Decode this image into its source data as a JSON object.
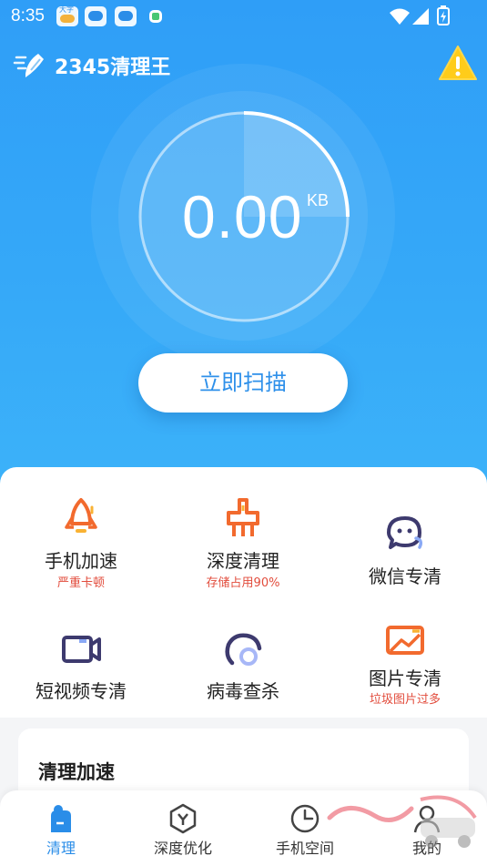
{
  "status_bar": {
    "time": "8:35",
    "notif_badge_text": "大字",
    "icons": [
      "weather-icon",
      "cloud-app-icon",
      "cloud-app-icon",
      "notification-icon",
      "wifi-icon",
      "signal-icon",
      "battery-icon"
    ]
  },
  "header": {
    "app_name": "2345清理王",
    "logo_icon": "broom-icon",
    "warning_icon": "warning-icon"
  },
  "scan": {
    "size_value": "0.00",
    "size_unit": "KB",
    "progress_fraction": 0.25,
    "scan_button": "立即扫描"
  },
  "features": [
    {
      "name": "手机加速",
      "sub": "严重卡顿",
      "icon": "rocket-icon"
    },
    {
      "name": "深度清理",
      "sub": "存储占用90%",
      "icon": "broom-deep-icon"
    },
    {
      "name": "微信专清",
      "sub": "",
      "icon": "wechat-icon"
    },
    {
      "name": "短视频专清",
      "sub": "",
      "icon": "video-icon"
    },
    {
      "name": "病毒查杀",
      "sub": "",
      "icon": "virus-shield-icon"
    },
    {
      "name": "图片专清",
      "sub": "垃圾图片过多",
      "icon": "image-icon"
    }
  ],
  "section": {
    "title": "清理加速"
  },
  "tabs": [
    {
      "label": "清理",
      "icon": "clean-icon",
      "active": true
    },
    {
      "label": "深度优化",
      "icon": "hexagon-icon",
      "active": false
    },
    {
      "label": "手机空间",
      "icon": "clock-icon",
      "active": false
    },
    {
      "label": "我的",
      "icon": "user-icon",
      "active": false
    }
  ],
  "colors": {
    "hero_blue": "#35a8f8",
    "accent_blue": "#2e90ea",
    "alert_red": "#e24c3c",
    "icon_orange": "#f26a2e",
    "icon_navy": "#3d3a6e",
    "warning_yellow": "#ffcc1a"
  }
}
